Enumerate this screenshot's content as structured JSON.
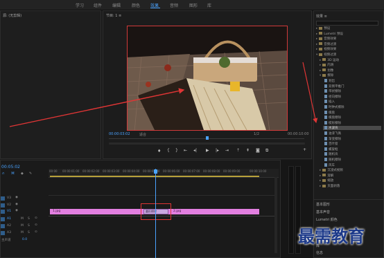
{
  "workspace_tabs": [
    "学习",
    "组件",
    "编辑",
    "颜色",
    "效果",
    "音频",
    "图形",
    "库"
  ],
  "active_tab": "效果",
  "source_panel": {
    "title": "源: (无剪辑)"
  },
  "program_monitor": {
    "title": "节目: 1 ≡",
    "timecode_current": "00:00:03:02",
    "fit_label": "适合",
    "resolution": "1/2",
    "timecode_total": "00:00:10:00"
  },
  "timeline": {
    "timecode": "00:05:02",
    "ruler_ticks": [
      "00:00",
      "00:00:01:00",
      "00:00:02:00",
      "00:00:03:00",
      "00:00:04:00",
      "00:00:05:00",
      "00:00:06:00",
      "00:00:07:00",
      "00:00:08:00",
      "00:00:09:00",
      "00:00:10:00"
    ],
    "tracks": [
      "V3",
      "V2",
      "V1",
      "A1",
      "A2",
      "A3",
      "主声道"
    ],
    "master_value": "0.0",
    "clip_left_label": "1.jpg",
    "transition_label": "圆形擦除",
    "clip_right_label": "2.jpg"
  },
  "effects_panel": {
    "title": "效果 ≡",
    "items": [
      {
        "label": "预设",
        "type": "folder",
        "indent": 0
      },
      {
        "label": "Lumetri 预设",
        "type": "folder",
        "indent": 0
      },
      {
        "label": "音频效果",
        "type": "folder",
        "indent": 0
      },
      {
        "label": "音频过渡",
        "type": "folder",
        "indent": 0
      },
      {
        "label": "视频效果",
        "type": "folder",
        "indent": 0
      },
      {
        "label": "视频过渡",
        "type": "folder",
        "indent": 0,
        "open": true
      },
      {
        "label": "3D 运动",
        "type": "folder",
        "indent": 1
      },
      {
        "label": "内滑",
        "type": "folder",
        "indent": 1
      },
      {
        "label": "划像",
        "type": "folder",
        "indent": 1
      },
      {
        "label": "擦除",
        "type": "folder",
        "indent": 1,
        "open": true
      },
      {
        "label": "划出",
        "type": "item",
        "indent": 2
      },
      {
        "label": "双侧平推门",
        "type": "item",
        "indent": 2
      },
      {
        "label": "带状擦除",
        "type": "item",
        "indent": 2
      },
      {
        "label": "径向擦除",
        "type": "item",
        "indent": 2
      },
      {
        "label": "插入",
        "type": "item",
        "indent": 2
      },
      {
        "label": "时钟式擦除",
        "type": "item",
        "indent": 2
      },
      {
        "label": "棋盘",
        "type": "item",
        "indent": 2
      },
      {
        "label": "棋盘擦除",
        "type": "item",
        "indent": 2
      },
      {
        "label": "楔形擦除",
        "type": "item",
        "indent": 2
      },
      {
        "label": "水波块",
        "type": "item",
        "indent": 2,
        "selected": true
      },
      {
        "label": "油漆飞溅",
        "type": "item",
        "indent": 2
      },
      {
        "label": "渐变擦除",
        "type": "item",
        "indent": 2
      },
      {
        "label": "百叶窗",
        "type": "item",
        "indent": 2
      },
      {
        "label": "螺旋框",
        "type": "item",
        "indent": 2
      },
      {
        "label": "随机块",
        "type": "item",
        "indent": 2
      },
      {
        "label": "随机擦除",
        "type": "item",
        "indent": 2
      },
      {
        "label": "风车",
        "type": "item",
        "indent": 2
      },
      {
        "label": "沉浸式视频",
        "type": "folder",
        "indent": 1
      },
      {
        "label": "溶解",
        "type": "folder",
        "indent": 1
      },
      {
        "label": "缩放",
        "type": "folder",
        "indent": 1
      },
      {
        "label": "页面剥落",
        "type": "folder",
        "indent": 1
      }
    ],
    "basic_graphics": "基本图形",
    "basic_sound": "基本声音",
    "lumetri_color": "Lumetri 颜色",
    "library": "库",
    "info": "信息"
  },
  "watermark": "最需教育",
  "colors": {
    "accent": "#4aa3ff",
    "clip": "#e27fe0",
    "highlight_box": "#e03535",
    "annotation_arrow": "#e03535"
  }
}
